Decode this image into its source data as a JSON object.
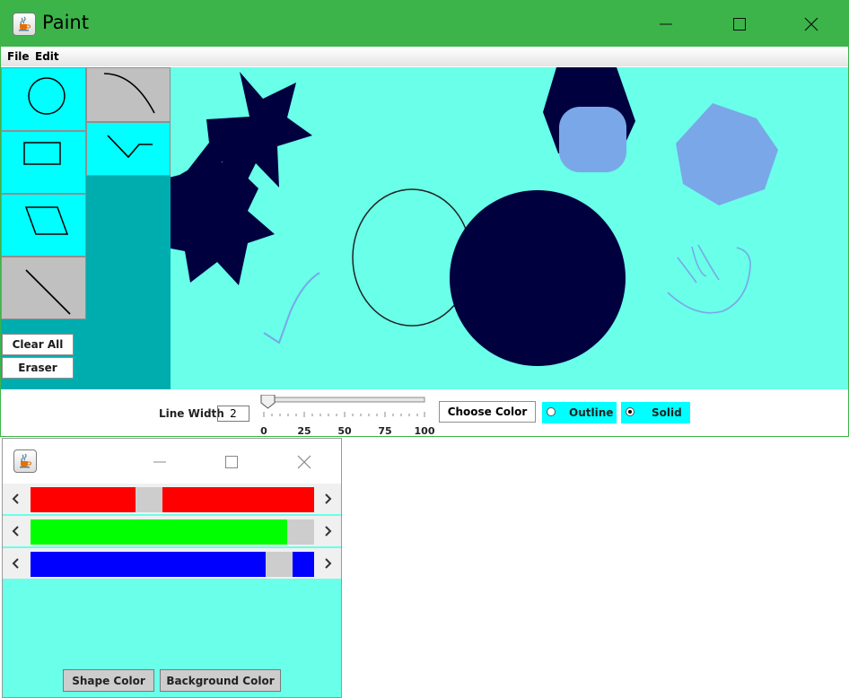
{
  "paint_window": {
    "title": "Paint",
    "icon": "java-cup-icon",
    "title_bar_color": "#3cb44a",
    "minimize_icon": "minimize-icon",
    "maximize_icon": "maximize-icon",
    "close_icon": "close-icon"
  },
  "menu": {
    "file": "File",
    "edit": "Edit"
  },
  "tools": [
    {
      "name": "circle-tool",
      "icon": "circle-icon",
      "selected": false
    },
    {
      "name": "rectangle-tool",
      "icon": "rectangle-icon",
      "selected": false
    },
    {
      "name": "parallelogram-tool",
      "icon": "parallelogram-icon",
      "selected": false
    },
    {
      "name": "line-tool",
      "icon": "line-icon",
      "selected": true
    },
    {
      "name": "curve-tool",
      "icon": "curve-icon",
      "selected": true
    },
    {
      "name": "polyline-tool",
      "icon": "polyline-icon",
      "selected": false
    }
  ],
  "panel_buttons": {
    "clear_all": "Clear All",
    "eraser": "Eraser"
  },
  "controls": {
    "line_width_label": "Line Width",
    "line_width_value": "2",
    "slider_ticks": [
      "0",
      "25",
      "50",
      "75",
      "100"
    ],
    "slider_value": 0,
    "choose_color": "Choose Color",
    "outline": "Outline",
    "solid": "Solid",
    "selected_fill_mode": "Solid"
  },
  "colors": {
    "canvas_bg": "#69ffe9",
    "tool_bg": "#00ffff",
    "tool_panel_bg": "#00adae",
    "shape_dark": "#01003f",
    "shape_light": "#7aa7e8"
  },
  "color_window": {
    "icon": "java-cup-icon",
    "minimize_icon": "minimize-icon",
    "maximize_icon": "maximize-icon",
    "close_icon": "close-icon",
    "sliders": [
      {
        "name": "red",
        "color": "#ff0000",
        "value_fraction": 0.38
      },
      {
        "name": "green",
        "color": "#00ff00",
        "value_fraction": 0.905
      },
      {
        "name": "blue",
        "color": "#0000ff",
        "value_fraction": 0.83
      }
    ],
    "shape_color_button": "Shape Color",
    "background_color_button": "Background Color"
  }
}
